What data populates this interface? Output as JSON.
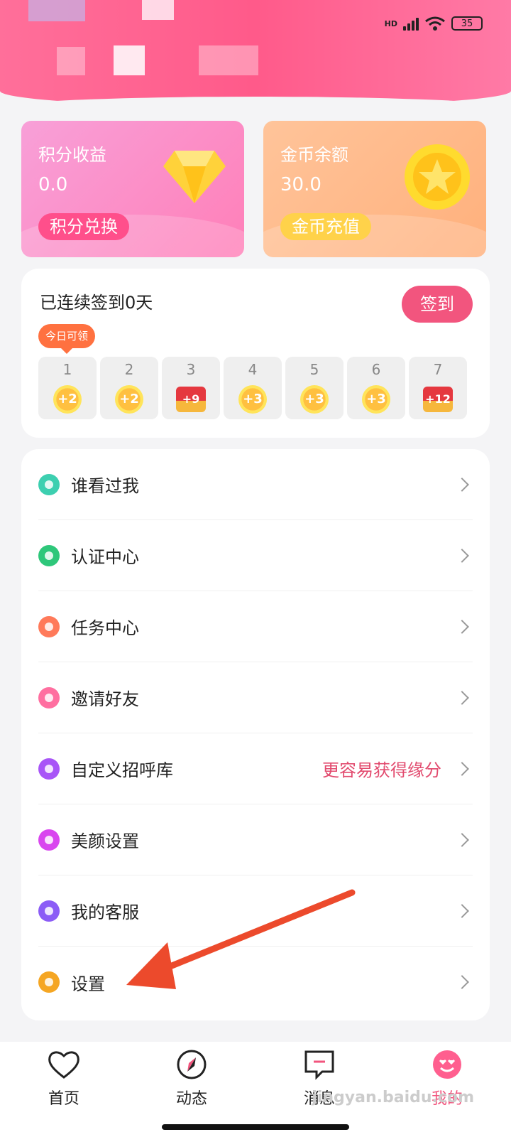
{
  "status": {
    "network": "HD",
    "battery": "35"
  },
  "points_card": {
    "title": "积分收益",
    "value": "0.0",
    "button": "积分兑换"
  },
  "gold_card": {
    "title": "金币余额",
    "value": "30.0",
    "button": "金币充值"
  },
  "signin": {
    "title": "已连续签到0天",
    "button": "签到",
    "tip": "今日可领",
    "days": [
      {
        "day": "1",
        "reward": "+2",
        "kind": "coin"
      },
      {
        "day": "2",
        "reward": "+2",
        "kind": "coin"
      },
      {
        "day": "3",
        "reward": "+9",
        "kind": "chest"
      },
      {
        "day": "4",
        "reward": "+3",
        "kind": "coin"
      },
      {
        "day": "5",
        "reward": "+3",
        "kind": "coin"
      },
      {
        "day": "6",
        "reward": "+3",
        "kind": "coin"
      },
      {
        "day": "7",
        "reward": "+12",
        "kind": "chest"
      }
    ]
  },
  "menu": [
    {
      "label": "谁看过我",
      "icon": "eye-icon",
      "color": "#3dcfb0"
    },
    {
      "label": "认证中心",
      "icon": "shield-check-icon",
      "color": "#2ec77a"
    },
    {
      "label": "任务中心",
      "icon": "diamond-task-icon",
      "color": "#ff7a5a"
    },
    {
      "label": "邀请好友",
      "icon": "envelope-icon",
      "color": "#ff6fa0"
    },
    {
      "label": "自定义招呼库",
      "icon": "heart-chat-icon",
      "color": "#a855f7",
      "hint": "更容易获得缘分"
    },
    {
      "label": "美颜设置",
      "icon": "smile-icon",
      "color": "#d946ef"
    },
    {
      "label": "我的客服",
      "icon": "headset-icon",
      "color": "#8b5cf6"
    },
    {
      "label": "设置",
      "icon": "hexagon-gear-icon",
      "color": "#f5a623"
    }
  ],
  "nav": [
    {
      "label": "首页",
      "icon": "heart-icon"
    },
    {
      "label": "动态",
      "icon": "compass-icon"
    },
    {
      "label": "消息",
      "icon": "message-icon"
    },
    {
      "label": "我的",
      "icon": "emoji-face-icon"
    }
  ],
  "watermark": "jingyan.baidu.com"
}
